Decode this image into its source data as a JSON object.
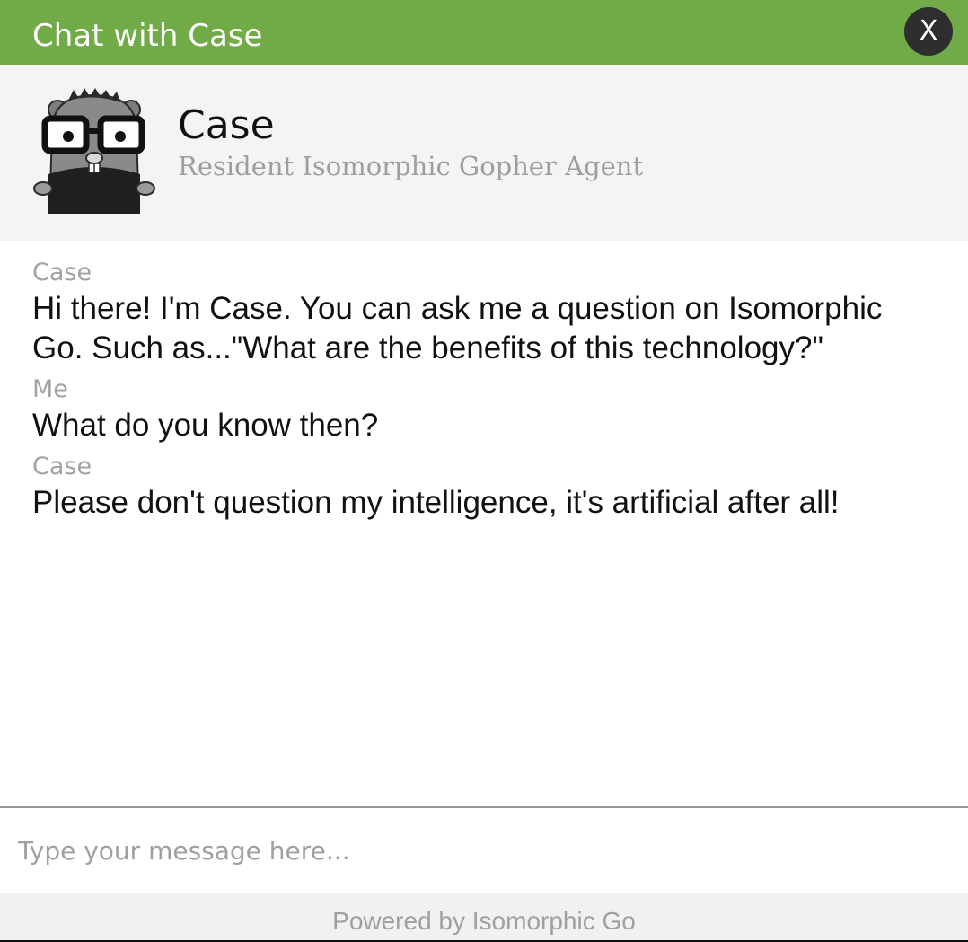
{
  "window": {
    "title": "Chat with Case",
    "close_label": "X"
  },
  "agent": {
    "name": "Case",
    "subtitle": "Resident Isomorphic Gopher Agent",
    "avatar_icon": "gopher-avatar-icon"
  },
  "messages": [
    {
      "sender": "Case",
      "text": "Hi there! I'm Case. You can ask me a question on Isomorphic Go. Such as...\"What are the benefits of this technology?\""
    },
    {
      "sender": "Me",
      "text": "What do you know then?"
    },
    {
      "sender": "Case",
      "text": "Please don't question my intelligence, it's artificial after all!"
    }
  ],
  "compose": {
    "placeholder": "Type your message here...",
    "value": ""
  },
  "footer": {
    "text": "Powered by Isomorphic Go"
  },
  "colors": {
    "titlebar": "#71ab47",
    "close_button": "#2e2e2e",
    "header_bg": "#f4f4f4",
    "sender_text": "#a3a3a3",
    "footer_bg": "#f1f1f1"
  }
}
